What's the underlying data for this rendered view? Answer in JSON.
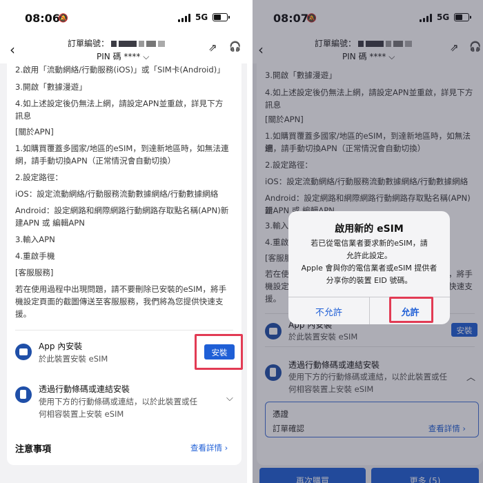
{
  "colors": {
    "accent": "#1f5fd6",
    "highlight": "#e23b54"
  },
  "left": {
    "time": "08:06",
    "network": "5G",
    "header": {
      "order_label": "訂單編號：",
      "pin_label": "PIN 碼 ****"
    },
    "lines": [
      "2.啟用「流動網絡/行動服務(iOS)」或「SIM卡(Android)」",
      "3.開啟「數據漫遊」",
      "4.如上述設定後仍無法上網，請設定APN並重啟，詳見下方",
      "訊息",
      "[關於APN]",
      "1.如購買覆蓋多國家/地區的eSIM，到達新地區時，如無法連",
      "網，請手動切換APN（正常情況會自動切換）",
      "2.設定路徑：",
      "iOS：設定流動網絡/行動服務流動數據網絡/行動數據網絡",
      "Android：設定網路和網際網路行動網路存取點名稱(APN)新",
      "建APN 或 編輯APN",
      "3.輸入APN",
      "4.重啟手機",
      "[客服服務]",
      "若在使用過程中出現問題，請不要刪除已安裝的eSIM，將手",
      "機設定頁面的截圖傳送至客服服務，我們將為您提供快速支",
      "援。"
    ],
    "app_install": {
      "title": "App 內安裝",
      "sub": "於此裝置安裝 eSIM",
      "button": "安裝"
    },
    "qr_install": {
      "title": "透過行動條碼或連結安裝",
      "sub1": "使用下方的行動條碼或連結，以於此裝置或任",
      "sub2": "何相容裝置上安裝 eSIM"
    },
    "notes": {
      "title": "注意事項",
      "details": "查看詳情"
    }
  },
  "right": {
    "time": "08:07",
    "network": "5G",
    "header": {
      "order_label": "訂單編號：",
      "pin_label": "PIN 碼 ****"
    },
    "lines": [
      "3.開啟「數據漫遊」",
      "4.如上述設定後仍無法上網，請設定APN並重啟，詳見下方",
      "訊息",
      "[關於APN]",
      "1.如購買覆蓋多國家/地區的eSIM，到達新地區時，如無法連",
      "網，請手動切換APN（正常情況會自動切換）",
      "2.設定路徑：",
      "iOS：設定流動網絡/行動服務流動數據網絡/行動數據網絡",
      "Android：設定網路和網際網路行動網路存取點名稱(APN)新",
      "建APN 或 編輯APN",
      "3.輸入",
      "4.重啟",
      "[客服服",
      "若在使",
      "機設定",
      "援。"
    ],
    "line_right_fragments": {
      "r1": "，將手",
      "r2": "快速支"
    },
    "app_install": {
      "title": "App 內安裝",
      "sub": "於此裝置安裝 eSIM",
      "button": "安裝"
    },
    "qr_install": {
      "title": "透過行動條碼或連結安裝",
      "sub1": "使用下方的行動條碼或連結，以於此裝置或任",
      "sub2": "何相容裝置上安裝 eSIM"
    },
    "voucher": {
      "title": "憑證",
      "sub": "訂單確認",
      "details": "查看詳情"
    },
    "bottom": {
      "btn1": "再次購買",
      "btn2": "更多 (5)"
    },
    "alert": {
      "title": "啟用新的 eSIM",
      "msg1": "若已從電信業者要求新的eSIM，請",
      "msg2": "允許此設定。",
      "msg3": "Apple 會與你的電信業者或eSIM 提供者",
      "msg4": "分享你的裝置 EID 號碼。",
      "deny": "不允許",
      "allow": "允許"
    }
  }
}
